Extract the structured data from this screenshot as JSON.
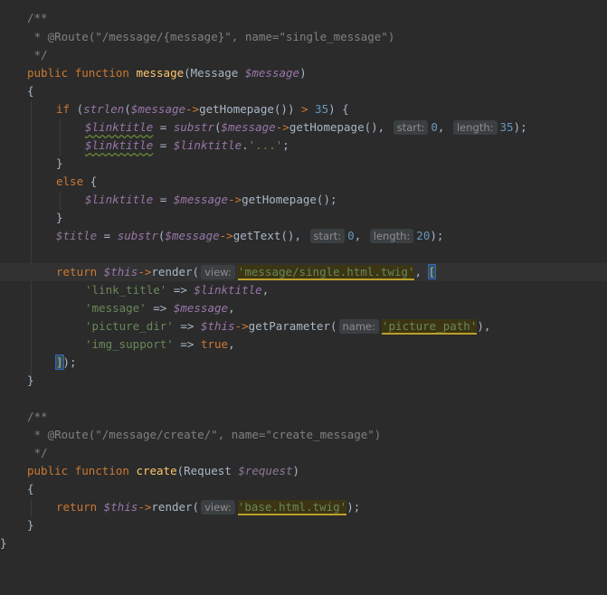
{
  "code": {
    "l1": "/**",
    "l2_prefix": " * ",
    "l2_ann": "@Route",
    "l2_rest": "(\"/message/{message}\", name=\"single_message\")",
    "l3": " */",
    "l4_public": "public",
    "l4_function": "function",
    "l4_name": "message",
    "l4_type": "(Message ",
    "l4_var": "$message",
    "l4_close": ")",
    "brace_open": "{",
    "brace_close": "}",
    "l6_if": "if",
    "l6_paren": " (",
    "l6_strlen": "strlen",
    "l6_p2": "(",
    "l6_var": "$message",
    "l6_arrow": "->",
    "l6_call": "getHomepage",
    "l6_p3": "()) ",
    "l6_gt": ">",
    "l6_num": " 35",
    "l6_end": ") {",
    "l7_var": "$linktitle",
    "l7_eq": " = ",
    "l7_substr": "substr",
    "l7_p": "(",
    "l7_var2": "$message",
    "l7_arrow": "->",
    "l7_call": "getHomepage",
    "l7_p2": "(), ",
    "l7_hint1": "start:",
    "l7_num1": "0",
    "l7_comma": ", ",
    "l7_hint2": "length:",
    "l7_num2": "35",
    "l7_end": ");",
    "l8_var": "$linktitle",
    "l8_eq": " = ",
    "l8_var2": "$linktitle",
    "l8_dot": ".",
    "l8_str": "'...'",
    "l8_end": ";",
    "l9": "}",
    "l10_else": "else",
    "l10_brace": " {",
    "l11_var": "$linktitle",
    "l11_eq": " = ",
    "l11_var2": "$message",
    "l11_arrow": "->",
    "l11_call": "getHomepage",
    "l11_end": "();",
    "l12": "}",
    "l13_var": "$title",
    "l13_eq": " = ",
    "l13_substr": "substr",
    "l13_p": "(",
    "l13_var2": "$message",
    "l13_arrow": "->",
    "l13_call": "getText",
    "l13_p2": "(), ",
    "l13_hint1": "start:",
    "l13_num1": "0",
    "l13_comma": ", ",
    "l13_hint2": "length:",
    "l13_num2": "20",
    "l13_end": ");",
    "l15_return": "return",
    "l15_this": "$this",
    "l15_arrow": "->",
    "l15_call": "render",
    "l15_p": "(",
    "l15_hint": "view:",
    "l15_str": "'message/single.html.twig'",
    "l15_comma": ", ",
    "l15_bracket": "[",
    "l16_key": "'link_title'",
    "l16_op": " => ",
    "l16_var": "$linktitle",
    "l16_end": ",",
    "l17_key": "'message'",
    "l17_op": " => ",
    "l17_var": "$message",
    "l17_end": ",",
    "l18_key": "'picture_dir'",
    "l18_op": " => ",
    "l18_this": "$this",
    "l18_arrow": "->",
    "l18_call": "getParameter",
    "l18_p": "(",
    "l18_hint": "name:",
    "l18_str": "'picture_path'",
    "l18_end": "),",
    "l19_key": "'img_support'",
    "l19_op": " => ",
    "l19_val": "true",
    "l19_end": ",",
    "l20_bracket": "]",
    "l20_end": ");",
    "l21": "}",
    "l23": "/**",
    "l24_prefix": " * ",
    "l24_ann": "@Route",
    "l24_rest": "(\"/message/create/\", name=\"create_message\")",
    "l25": " */",
    "l26_public": "public",
    "l26_function": "function",
    "l26_name": "create",
    "l26_type": "(Request ",
    "l26_var": "$request",
    "l26_close": ")",
    "l28_return": "return",
    "l28_this": "$this",
    "l28_arrow": "->",
    "l28_call": "render",
    "l28_p": "(",
    "l28_hint": "view:",
    "l28_str": "'base.html.twig'",
    "l28_end": ");",
    "l29": "}",
    "l30": "}"
  }
}
